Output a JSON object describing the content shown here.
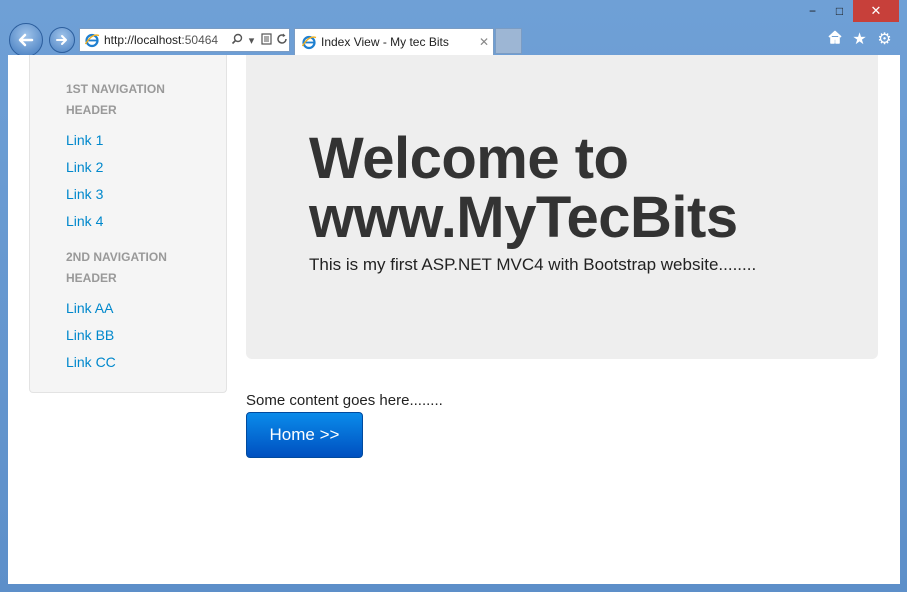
{
  "window": {
    "minimize": "−",
    "maximize": "□",
    "close": "✕"
  },
  "browser": {
    "url_host": "http://localhost",
    "url_port": ":50464",
    "tab_title": "Index View - My tec Bits",
    "icons": [
      "back-icon",
      "forward-icon",
      "ie-logo-icon",
      "search-icon",
      "dropdown-icon",
      "compatibility-icon",
      "refresh-icon",
      "tab-close-icon",
      "home-icon",
      "favorites-icon",
      "settings-icon"
    ]
  },
  "sidebar": {
    "header1": "1ST NAVIGATION HEADER",
    "links1": [
      "Link 1",
      "Link 2",
      "Link 3",
      "Link 4"
    ],
    "header2": "2ND NAVIGATION HEADER",
    "links2": [
      "Link AA",
      "Link BB",
      "Link CC"
    ]
  },
  "hero": {
    "title_line1": "Welcome to",
    "title_line2": "www.MyTecBits",
    "subtitle": "This is my first ASP.NET MVC4 with Bootstrap website........"
  },
  "main": {
    "content_text": "Some content goes here........",
    "home_button": "Home >>"
  },
  "colors": {
    "link": "#0088cc",
    "hero_bg": "#eeeeee",
    "button": "#0066cc",
    "frame": "#6b9bd2"
  }
}
